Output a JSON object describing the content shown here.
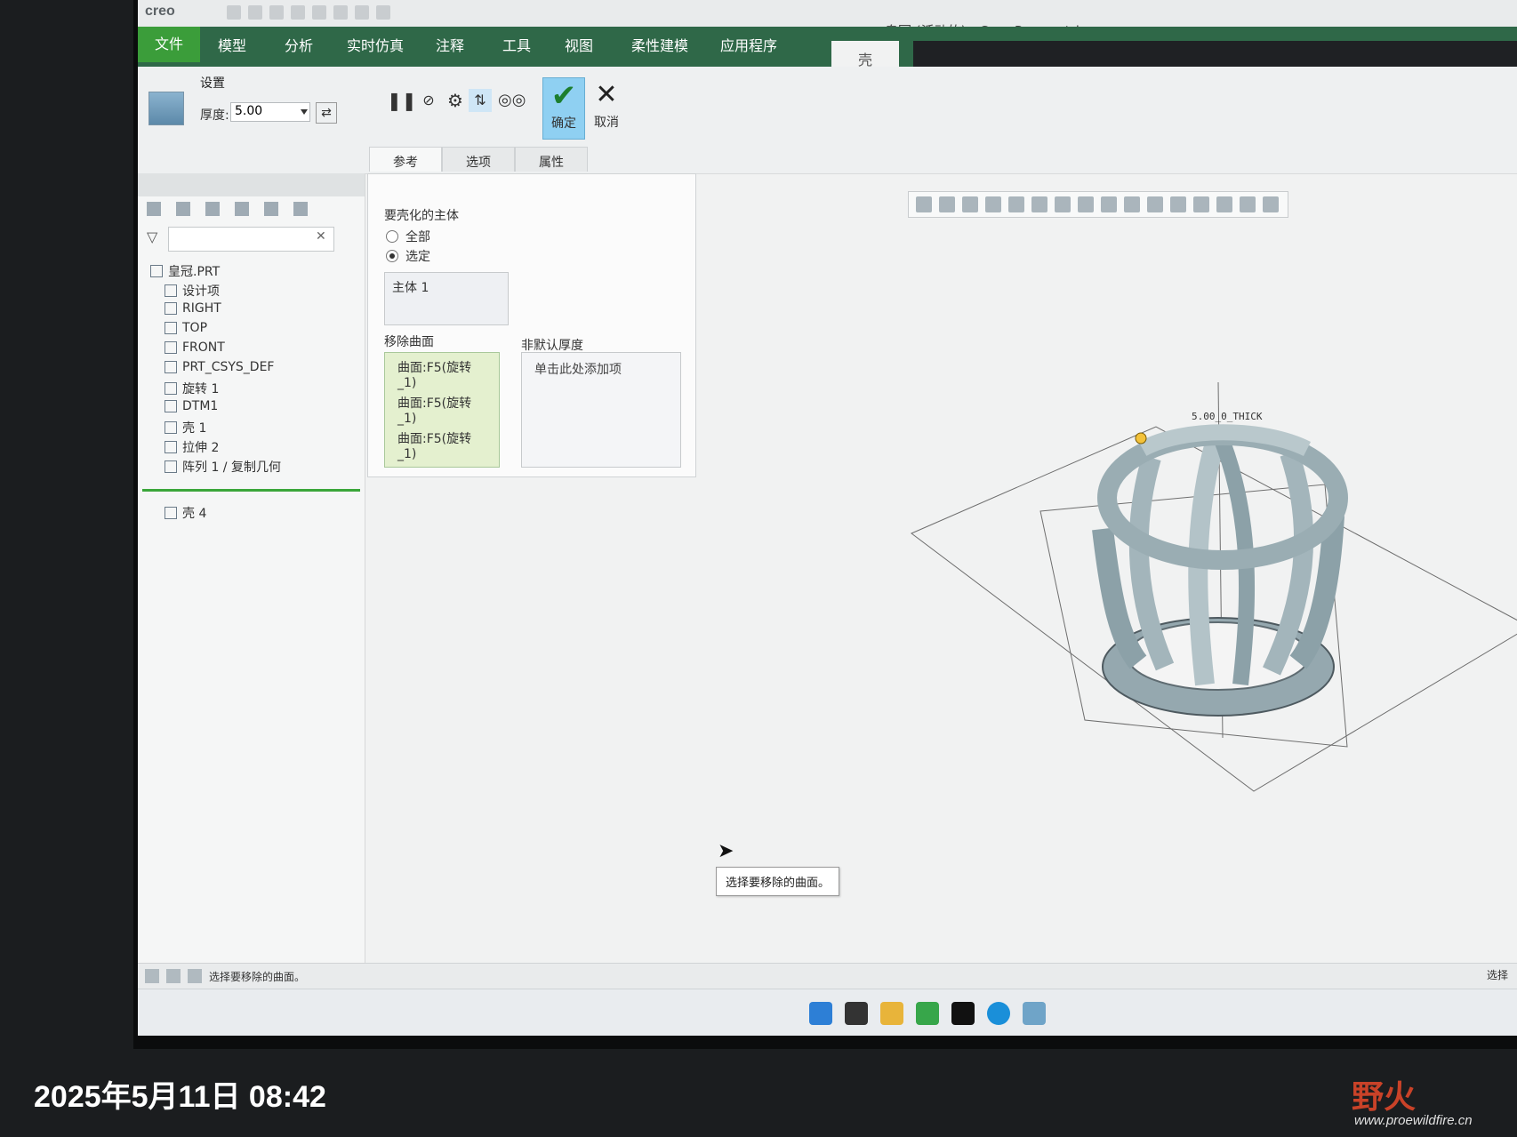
{
  "window": {
    "app_logo": "creo",
    "title": "皇冠 (活动的) - Creo Parametric"
  },
  "menu": {
    "file": "文件",
    "tabs": [
      "模型",
      "分析",
      "实时仿真",
      "注释",
      "工具",
      "视图",
      "柔性建模",
      "应用程序"
    ],
    "active_tab": "壳"
  },
  "ribbon": {
    "group_label": "设置",
    "thickness_label": "厚度:",
    "thickness_value": "5.00",
    "ok_label": "确定",
    "cancel_label": "取消",
    "subtabs": [
      "参考",
      "选项",
      "属性"
    ]
  },
  "tree": {
    "items": [
      {
        "label": "皇冠.PRT",
        "icon": "part-icon"
      },
      {
        "label": "设计项",
        "icon": "design-items-icon"
      },
      {
        "label": "RIGHT",
        "icon": "datum-plane-icon"
      },
      {
        "label": "TOP",
        "icon": "datum-plane-icon"
      },
      {
        "label": "FRONT",
        "icon": "datum-plane-icon"
      },
      {
        "label": "PRT_CSYS_DEF",
        "icon": "csys-icon"
      },
      {
        "label": "旋转 1",
        "icon": "revolve-icon"
      },
      {
        "label": "DTM1",
        "icon": "datum-plane-icon"
      },
      {
        "label": "壳 1",
        "icon": "shell-icon"
      },
      {
        "label": "拉伸 2",
        "icon": "extrude-icon"
      },
      {
        "label": "阵列 1 / 复制几何",
        "icon": "pattern-icon"
      },
      {
        "label": "壳 4",
        "icon": "shell-icon"
      }
    ]
  },
  "panel": {
    "body_title": "要壳化的主体",
    "radio_all": "全部",
    "radio_selected": "选定",
    "body_item": "主体 1",
    "remove_title": "移除曲面",
    "remove_items": [
      "曲面:F5(旋转_1)",
      "曲面:F5(旋转_1)",
      "曲面:F5(旋转_1)"
    ],
    "thick_title": "非默认厚度",
    "thick_placeholder": "单击此处添加项"
  },
  "graphics": {
    "dim_label": "5.00_0_THICK",
    "tooltip": "选择要移除的曲面。"
  },
  "status": {
    "message": "选择要移除的曲面。",
    "filter": "选择"
  },
  "photo": {
    "timestamp": "2025年5月11日 08:42",
    "watermark": "野火",
    "watermark_url": "www.proewildfire.cn"
  },
  "colors": {
    "file_tab": "#3b9d3a",
    "menu_bg": "#2f6848",
    "ok_bg": "#8fd0f2",
    "model": "#9fb2b8"
  }
}
